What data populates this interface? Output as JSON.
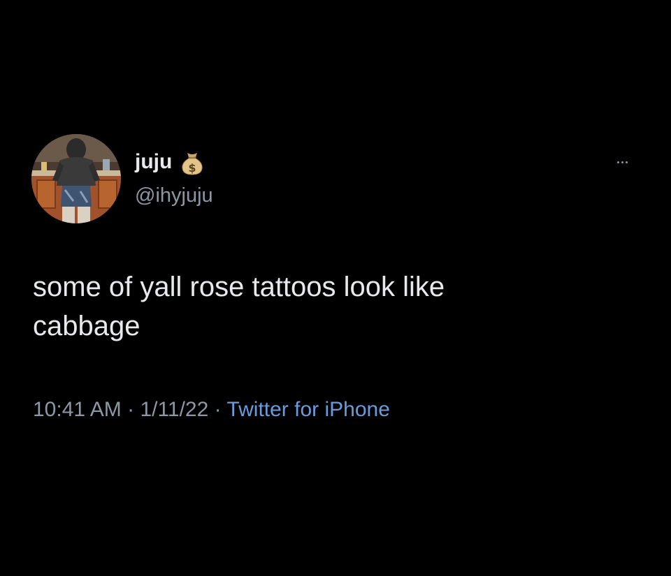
{
  "tweet": {
    "author": {
      "display_name": "juju",
      "handle": "@ihyjuju",
      "badge_emoji": "money-bag-icon"
    },
    "text": "some of yall rose tattoos look like\ncabbage",
    "meta": {
      "time": "10:41 AM",
      "separator": " · ",
      "date": "1/11/22",
      "source": "Twitter for iPhone"
    }
  },
  "colors": {
    "background": "#000000",
    "primary_text": "#e7e9ea",
    "secondary_text": "#8b98a5",
    "link": "#6a9bdc"
  }
}
